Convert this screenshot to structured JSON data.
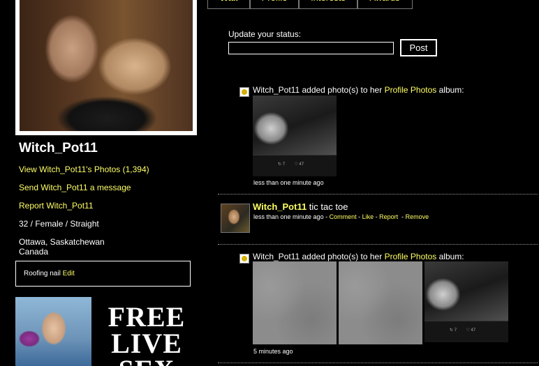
{
  "profile": {
    "username": "Witch_Pot11",
    "photos_link": "View Witch_Pot11's Photos (1,394)",
    "message_link": "Send Witch_Pot11 a message",
    "report_link": "Report Witch_Pot11",
    "demographics": "32 / Female / Straight",
    "location_line1": "Ottawa, Saskatchewan",
    "location_line2": "Canada",
    "about_text": "Roofing nail",
    "about_edit": "Edit"
  },
  "ad": {
    "text": "FREE LIVE SEX"
  },
  "tabs": [
    "Wall",
    "Profile",
    "Interests",
    "Awards"
  ],
  "status": {
    "label": "Update your status:",
    "value": "",
    "post_label": "Post"
  },
  "feed": [
    {
      "prefix": "Witch_Pot11 added photo(s) to her ",
      "album": "Profile Photos",
      "suffix": " album:",
      "time": "less than one minute ago"
    },
    {
      "author": "Witch_Pot11",
      "text": " tic tac toe",
      "time": "less than one minute ago",
      "actions": [
        "Comment",
        "Like",
        "Report",
        "Remove"
      ]
    },
    {
      "prefix": "Witch_Pot11 added photo(s) to her ",
      "album": "Profile Photos",
      "suffix": " album:",
      "time": "5 minutes ago"
    }
  ]
}
